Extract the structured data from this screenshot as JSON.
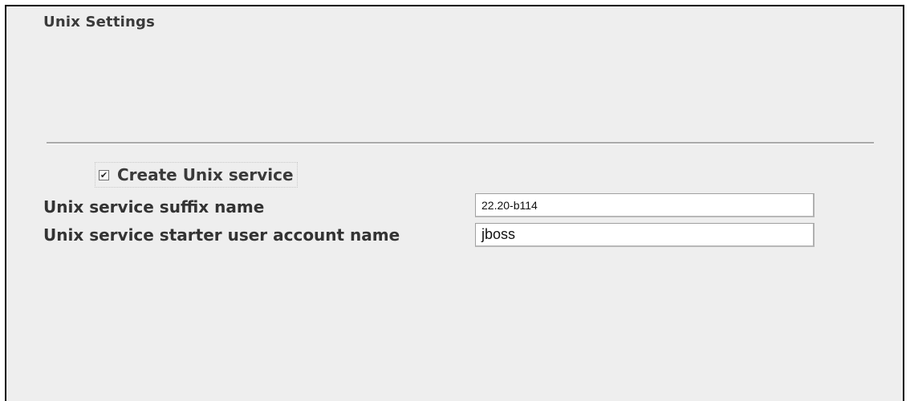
{
  "section": {
    "title": "Unix Settings"
  },
  "create_service": {
    "label": "Create Unix service",
    "checked": true,
    "check_glyph": "✔"
  },
  "fields": {
    "suffix_label": "Unix service suffix name",
    "suffix_value": "22.20-b114",
    "account_label": "Unix service starter user account name",
    "account_value": "jboss"
  }
}
